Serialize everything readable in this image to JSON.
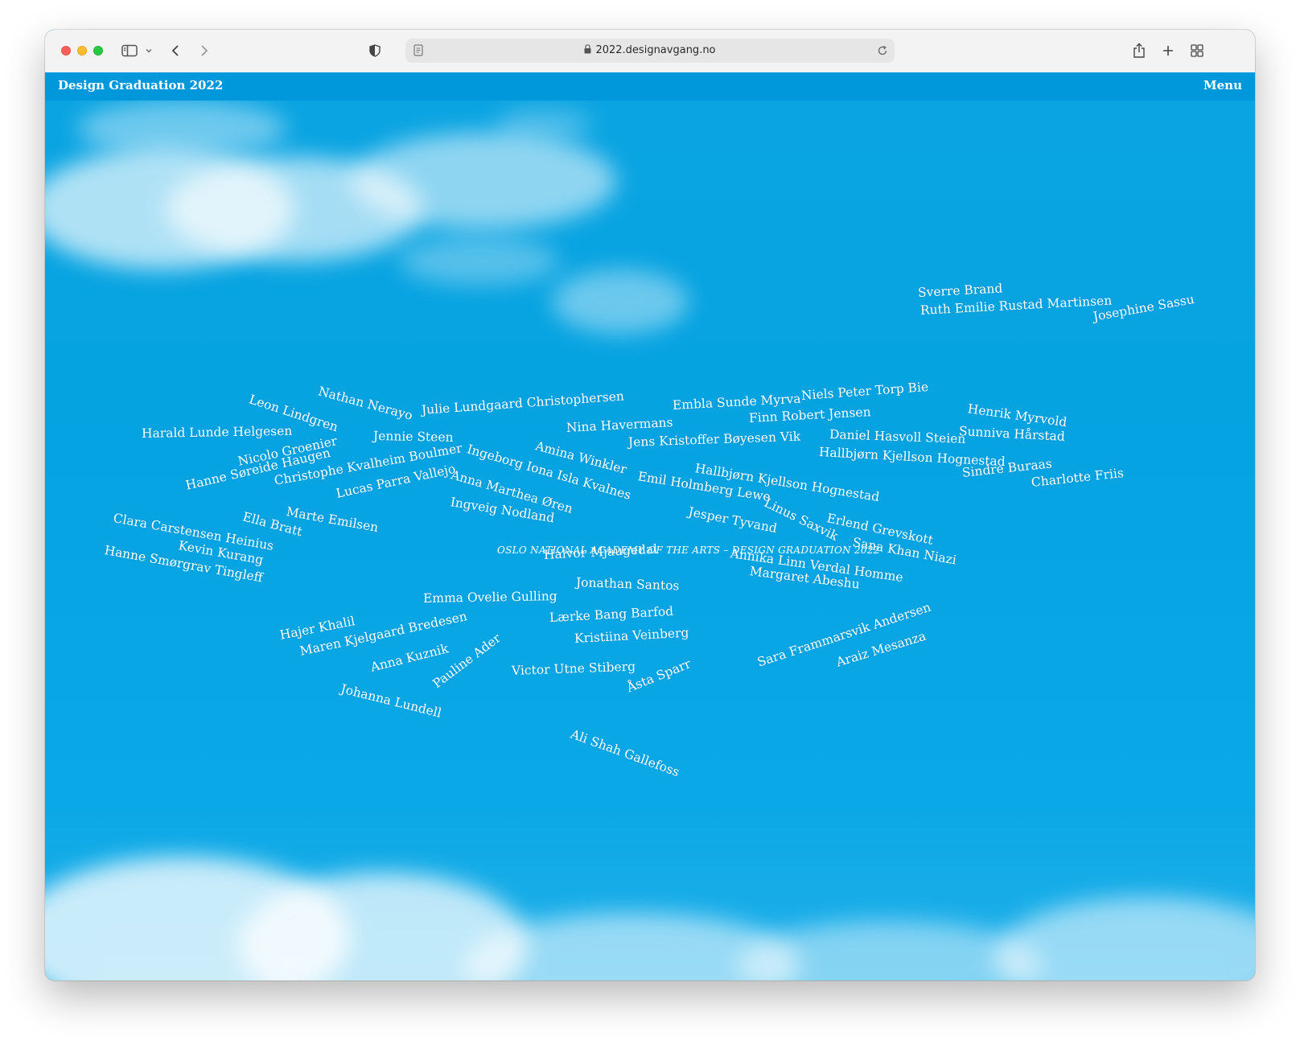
{
  "browser": {
    "url": "2022.designavgang.no"
  },
  "site": {
    "title": "Design Graduation 2022",
    "menu_label": "Menu",
    "tagline": "OSLO NATIONAL ACADEMY OF THE ARTS – DESIGN GRADUATION 2022"
  },
  "colors": {
    "sky": "#05a3e1",
    "header": "#0197db",
    "text": "#ffffff"
  },
  "students": [
    "Sverre Brand",
    "Ruth Emilie Rustad Martinsen",
    "Josephine Sassu",
    "Nathan Nerayo",
    "Leon Lindgren",
    "Julie Lundgaard Christophersen",
    "Embla Sunde Myrva",
    "Niels Peter Torp Bie",
    "Henrik Myrvold",
    "Harald Lunde Helgesen",
    "Jennie Steen",
    "Nina Havermans",
    "Finn Robert Jensen",
    "Sunniva Hårstad",
    "Daniel Hasvoll Steien",
    "Jens Kristoffer Bøyesen Vik",
    "Nicolo Groenier",
    "Amina Winkler",
    "Ingeborg Iona Isla Kvalnes",
    "Hallbjørn Kjellson Hognestad",
    "Hanne Søreide Haugen",
    "Christophe Kvalheim Boulmer",
    "Hallbjørn Kjellson Hognestad",
    "Sindre Buraas",
    "Anna Marthea Øren",
    "Emil Holmberg Lewe",
    "Charlotte Friis",
    "Lucas Parra Vallejo",
    "Ingveig Nodland",
    "Marte Emilsen",
    "Linus Saxvik",
    "Jesper Tyvand",
    "Erlend Grevskott",
    "Clara Carstensen Heinius",
    "Ella Bratt",
    "Sana Khan Niazi",
    "Kevin Kurang",
    "Halvor Mjaugedal",
    "Annika Linn Verdal Homme",
    "Hanne Smørgrav Tingleff",
    "Margaret Abeshu",
    "Jonathan Santos",
    "Emma Ovelie Gulling",
    "Lærke Bang Barfod",
    "Hajer Khalil",
    "Maren Kjelgaard Bredesen",
    "Kristiina Veinberg",
    "Sara Frammarsvik Andersen",
    "Anna Kuznik",
    "Pauline Ader",
    "Araiz Mesanza",
    "Victor Utne Stiberg",
    "Åsta Sparr",
    "Johanna Lundell",
    "Ali Shah Gallefoss"
  ]
}
